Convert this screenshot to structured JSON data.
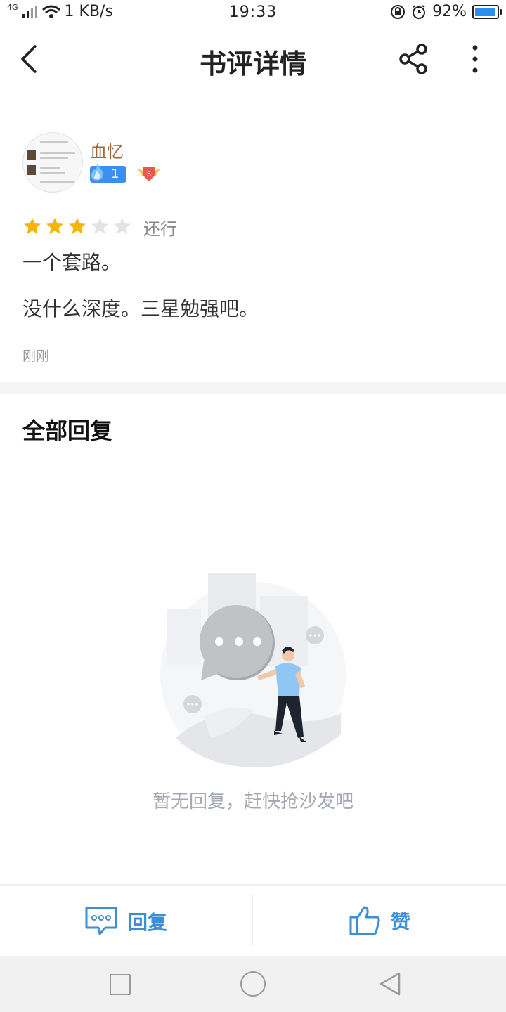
{
  "status_bar": {
    "network": "4G",
    "speed": "1 KB/s",
    "time": "19:33",
    "battery": "92%"
  },
  "header": {
    "title": "书评详情",
    "icons": [
      "back-icon",
      "share-icon",
      "more-icon"
    ]
  },
  "review": {
    "username": "血忆",
    "user_level": "1",
    "medal_level": "5",
    "rating": 3,
    "rating_max": 5,
    "rating_text": "还行",
    "title": "一个套路。",
    "body": "没什么深度。三星勉强吧。",
    "time": "刚刚"
  },
  "replies": {
    "section_title": "全部回复",
    "empty_text": "暂无回复，赶快抢沙发吧"
  },
  "bottom_bar": {
    "reply_label": "回复",
    "like_label": "赞"
  },
  "colors": {
    "accent": "#3b8fd6",
    "star_on": "#f6b500",
    "star_off": "#e3e3e3",
    "username": "#a0673d"
  }
}
